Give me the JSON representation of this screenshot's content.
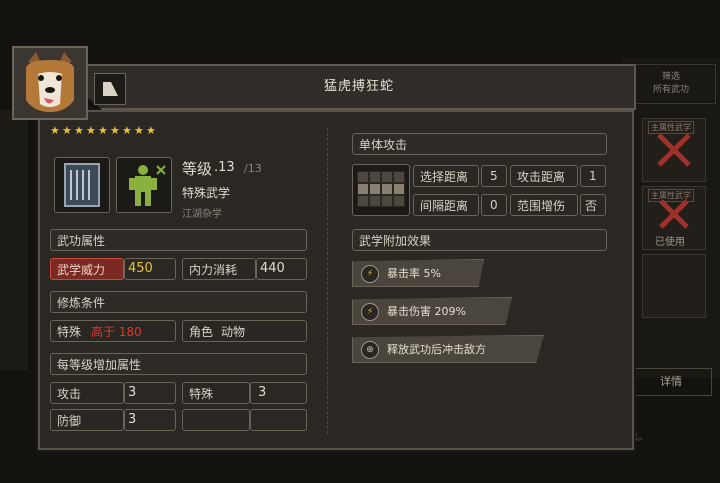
{
  "title": "猛虎搏狂蛇",
  "stars_count": 9,
  "level": {
    "label": "等级",
    "value": ".13",
    "max": "/13"
  },
  "type_label": "特殊武学",
  "school_label": "江湖杂学",
  "attr_header": "武功属性",
  "attrs": [
    {
      "label": "武学威力",
      "value": "450"
    },
    {
      "label": "内力消耗",
      "value": "440"
    }
  ],
  "cond_header": "修炼条件",
  "conds": [
    {
      "label": "特殊",
      "value": "高于 180"
    },
    {
      "label": "角色",
      "value": "动物"
    }
  ],
  "per_level_header": "每等级增加属性",
  "per_level": [
    {
      "label": "攻击",
      "value": "3"
    },
    {
      "label": "特殊",
      "value": "3"
    },
    {
      "label": "防御",
      "value": "3"
    },
    {
      "label": "",
      "value": ""
    }
  ],
  "attack_header": "单体攻击",
  "range": [
    {
      "label": "选择距离",
      "value": "5"
    },
    {
      "label": "攻击距离",
      "value": "1"
    },
    {
      "label": "间隔距离",
      "value": "0"
    },
    {
      "label": "范围增伤",
      "value": "否"
    }
  ],
  "effects_header": "武学附加效果",
  "effects": [
    {
      "icon": "lightning-icon",
      "text": "暴击率 5%"
    },
    {
      "icon": "lightning-icon",
      "text": "暴击伤害 209%"
    },
    {
      "icon": "crosshair-icon",
      "text": "释放武功后冲击敌方"
    }
  ],
  "background": {
    "filter_line1": "筛选",
    "filter_line2": "所有武功",
    "tag1": "主属性武学",
    "tag2": "主属性武学",
    "used": "已使用",
    "detail_button": "详情",
    "hint": "法。"
  },
  "colors": {
    "accent_red": "#d63a2e",
    "value_gold": "#e8c23a",
    "star": "#e8c23a"
  }
}
